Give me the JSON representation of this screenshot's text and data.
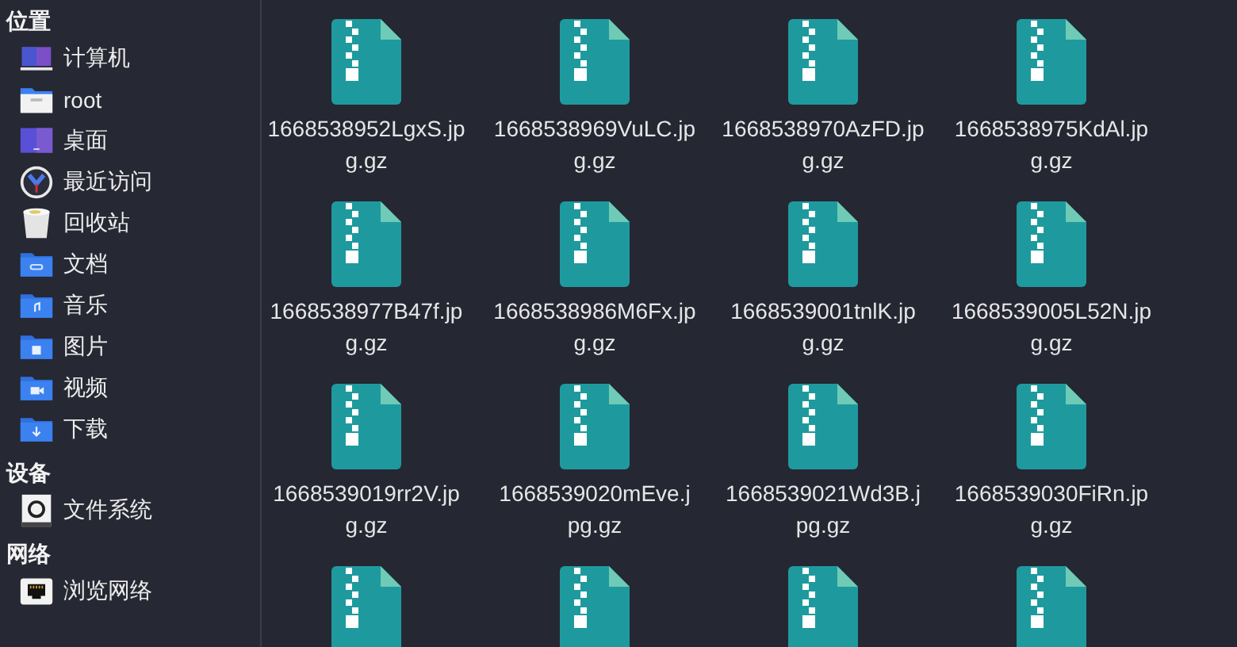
{
  "sidebar": {
    "sections": [
      {
        "heading": "位置",
        "items": [
          {
            "label": "计算机",
            "kind": "computer"
          },
          {
            "label": "root",
            "kind": "home"
          },
          {
            "label": "桌面",
            "kind": "desktop"
          },
          {
            "label": "最近访问",
            "kind": "recent"
          },
          {
            "label": "回收站",
            "kind": "trash"
          },
          {
            "label": "文档",
            "kind": "documents"
          },
          {
            "label": "音乐",
            "kind": "music"
          },
          {
            "label": "图片",
            "kind": "pictures"
          },
          {
            "label": "视频",
            "kind": "videos"
          },
          {
            "label": "下载",
            "kind": "downloads"
          }
        ]
      },
      {
        "heading": "设备",
        "items": [
          {
            "label": "文件系统",
            "kind": "drive"
          }
        ]
      },
      {
        "heading": "网络",
        "items": [
          {
            "label": "浏览网络",
            "kind": "network"
          }
        ]
      }
    ]
  },
  "files": [
    {
      "kind": "archive",
      "name": "1668538952LgxS.jpg.gz"
    },
    {
      "kind": "archive",
      "name": "1668538969VuLC.jpg.gz"
    },
    {
      "kind": "archive",
      "name": "1668538970AzFD.jpg.gz"
    },
    {
      "kind": "archive",
      "name": "1668538975KdAl.jpg.gz"
    },
    {
      "kind": "archive",
      "name": "1668538977B47f.jpg.gz"
    },
    {
      "kind": "archive",
      "name": "1668538986M6Fx.jpg.gz"
    },
    {
      "kind": "archive",
      "name": "1668539001tnlK.jpg.gz"
    },
    {
      "kind": "archive",
      "name": "1668539005L52N.jpg.gz"
    },
    {
      "kind": "archive",
      "name": "1668539019rr2V.jpg.gz"
    },
    {
      "kind": "archive",
      "name": "1668539020mEve.jpg.gz"
    },
    {
      "kind": "archive",
      "name": "1668539021Wd3B.jpg.gz"
    },
    {
      "kind": "archive",
      "name": "1668539030FiRn.jpg.gz"
    },
    {
      "kind": "archive"
    },
    {
      "kind": "archive"
    },
    {
      "kind": "archive"
    },
    {
      "kind": "archive"
    }
  ]
}
